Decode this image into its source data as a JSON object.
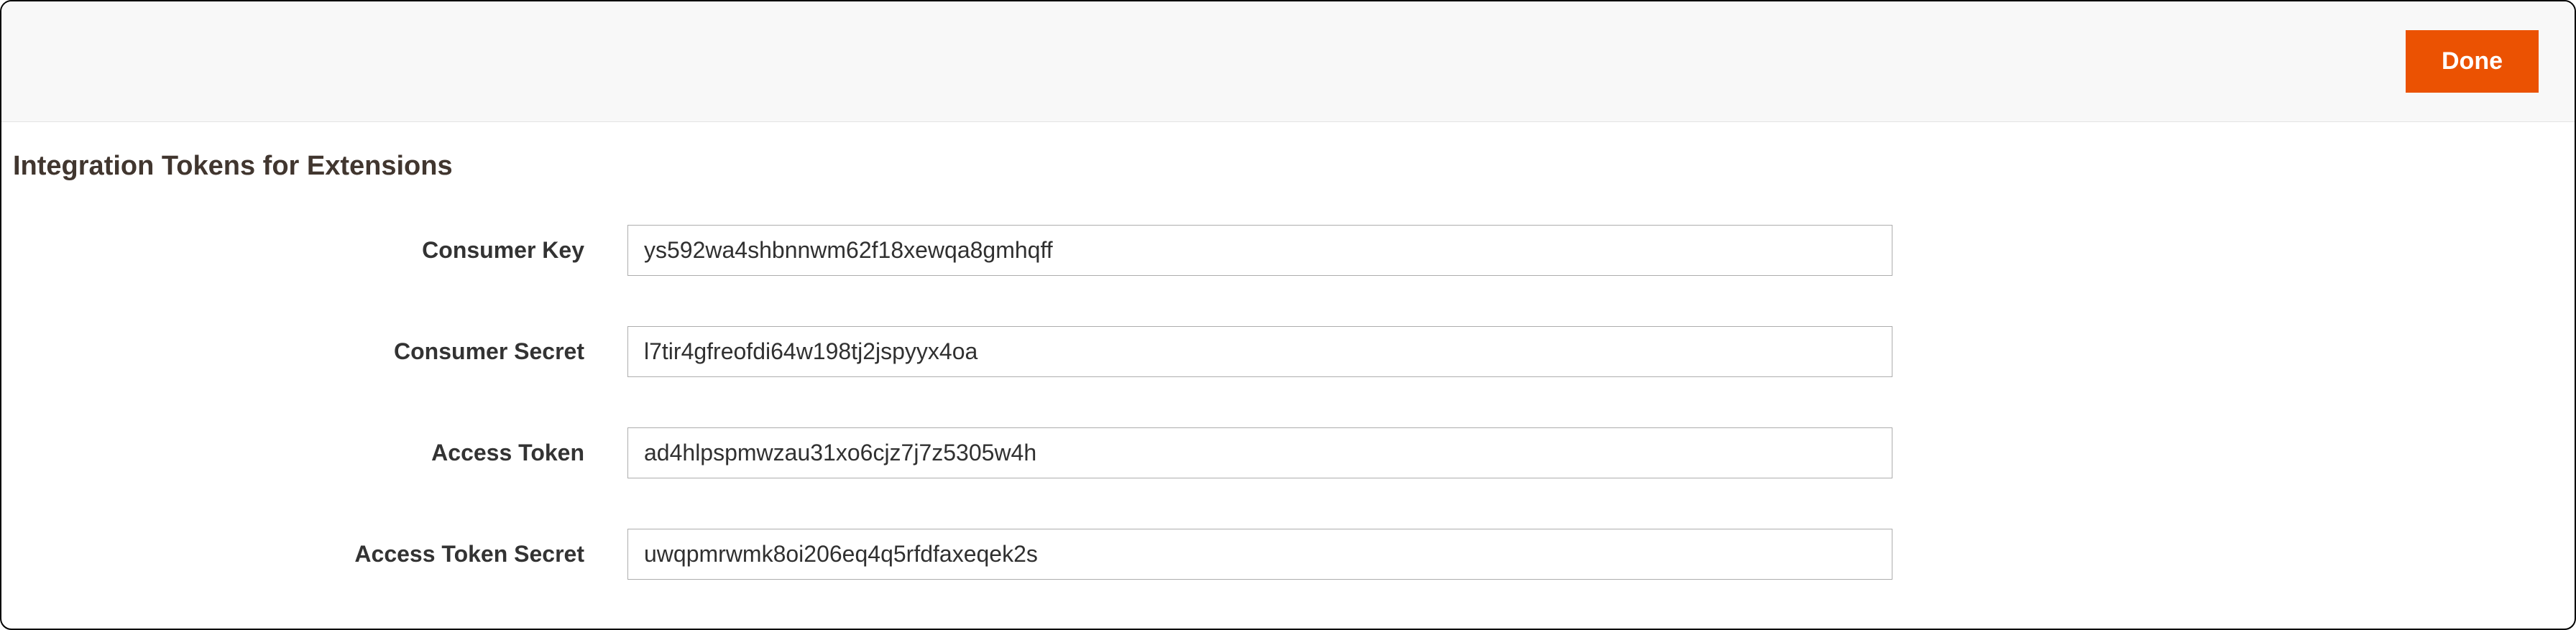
{
  "header": {
    "done_label": "Done"
  },
  "section": {
    "title": "Integration Tokens for Extensions"
  },
  "fields": {
    "consumer_key": {
      "label": "Consumer Key",
      "value": "ys592wa4shbnnwm62f18xewqa8gmhqff"
    },
    "consumer_secret": {
      "label": "Consumer Secret",
      "value": "l7tir4gfreofdi64w198tj2jspyyx4oa"
    },
    "access_token": {
      "label": "Access Token",
      "value": "ad4hlpspmwzau31xo6cjz7j7z5305w4h"
    },
    "access_token_secret": {
      "label": "Access Token Secret",
      "value": "uwqpmrwmk8oi206eq4q5rfdfaxeqek2s"
    }
  }
}
